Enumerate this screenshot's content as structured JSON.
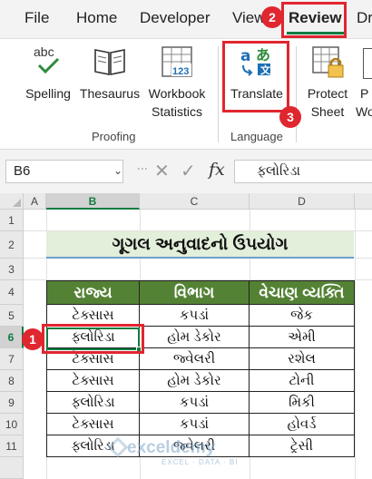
{
  "menu": {
    "tabs": [
      "File",
      "Home",
      "Developer",
      "View",
      "Review",
      "Dra"
    ],
    "active": "Review"
  },
  "ribbon": {
    "buttons": {
      "spelling": "Spelling",
      "thesaurus": "Thesaurus",
      "workbook_1": "Workbook",
      "workbook_2": "Statistics",
      "translate": "Translate",
      "protect_1": "Protect",
      "protect_2": "Sheet",
      "partial_1": "P",
      "partial_2": "Wo"
    },
    "icon_text": {
      "abc": "abc",
      "stats_number": "123"
    },
    "groups": {
      "proofing": "Proofing",
      "language": "Language"
    }
  },
  "formula_bar": {
    "name_box": "B6",
    "formula": "ફ્લોરિડા",
    "fx": "fx"
  },
  "grid": {
    "columns": [
      "A",
      "B",
      "C",
      "D"
    ],
    "rows": [
      "1",
      "2",
      "3",
      "4",
      "5",
      "6",
      "7",
      "8",
      "9",
      "10",
      "11"
    ],
    "title": "ગૂગલ અનુવાદનો ઉપયોગ"
  },
  "table": {
    "headers": [
      "રાજ્ય",
      "વિભાગ",
      "વેચાણ વ્યક્તિ"
    ],
    "rows": [
      [
        "ટેક્સાસ",
        "કપડાં",
        "જેક"
      ],
      [
        "ફ્લોરિડા",
        "હોમ ડેકોર",
        "એમી"
      ],
      [
        "ટેક્સાસ",
        "જ્વેલરી",
        "રશેલ"
      ],
      [
        "ટેક્સાસ",
        "હોમ ડેકોર",
        "ટોની"
      ],
      [
        "ફ્લોરિડા",
        "કપડાં",
        "મિકી"
      ],
      [
        "ટેક્સાસ",
        "કપડાં",
        "હોવર્ડ"
      ],
      [
        "ફ્લોરિડા",
        "જ્વેલરી",
        "ટ્રેસી"
      ]
    ]
  },
  "annotations": [
    "1",
    "2",
    "3"
  ],
  "watermark": {
    "name": "exceldemy",
    "tagline": "EXCEL · DATA · BI"
  },
  "colors": {
    "excel_green": "#107c41",
    "header_green": "#548235",
    "title_fill": "#e2efda",
    "annotation_red": "#e0262f"
  }
}
